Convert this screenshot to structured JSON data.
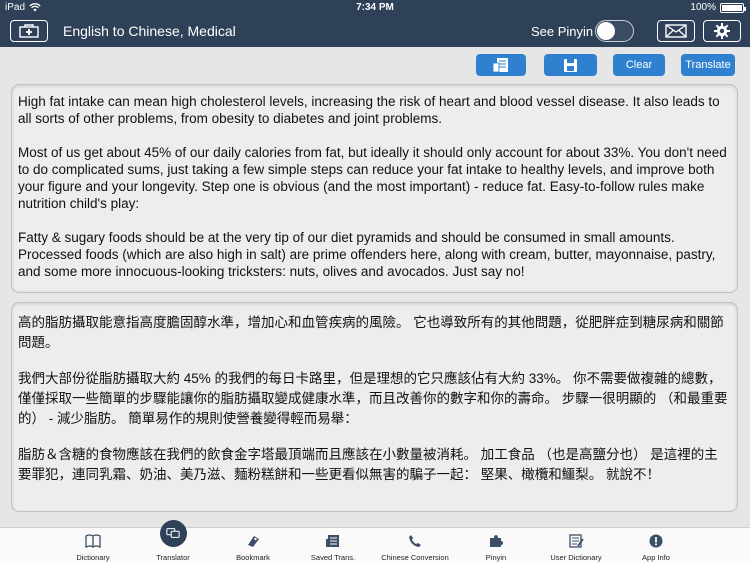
{
  "status_bar": {
    "device": "iPad",
    "time": "7:34 PM",
    "battery": "100%",
    "battery_level": 1.0
  },
  "navbar": {
    "title": "English to Chinese, Medical",
    "pinyin_label": "See Pinyin",
    "pinyin_toggle_on": false
  },
  "toolbar": {
    "clear_label": "Clear",
    "translate_label": "Translate"
  },
  "source_text": {
    "p1": "High fat intake can mean high cholesterol levels, increasing the risk of heart and blood vessel disease. It also leads to all sorts of other problems, from obesity to diabetes and joint problems.",
    "p2": "Most of us get about 45% of our daily calories from fat, but ideally it should only account for about 33%. You don't need to do complicated sums, just taking a few simple steps can reduce your fat intake to healthy levels, and improve both your figure and your longevity. Step one is obvious (and the most important) - reduce fat. Easy-to-follow rules make nutrition child's play:",
    "p3": "Fatty & sugary foods should be at the very tip of our diet pyramids and should be consumed in small amounts. Processed foods (which are also high in salt) are prime offenders here, along with cream, butter, mayonnaise, pastry, and some more innocuous-looking tricksters: nuts, olives and avocados. Just say no!"
  },
  "translated_text": {
    "p1": "高的脂肪攝取能意指高度膽固醇水準，增加心和血管疾病的風險。 它也導致所有的其他問題，從肥胖症到糖尿病和關節問題。",
    "p2": "我們大部份從脂肪攝取大約 45% 的我們的每日卡路里，但是理想的它只應該佔有大約 33%。 你不需要做複雜的總數，僅僅採取一些簡單的步驟能讓你的脂肪攝取變成健康水準，而且改善你的數字和你的壽命。 步驟一很明顯的 （和最重要的） - 減少脂肪。 簡單易作的規則使營養變得輕而易舉：",
    "p3": "脂肪＆含糖的食物應該在我們的飲食金字塔最頂端而且應該在小數量被消耗。 加工食品 （也是高鹽分也） 是這裡的主要罪犯，連同乳霜、奶油、美乃滋、麵粉糕餅和一些更看似無害的騙子一起： 堅果、橄欖和鱷梨。 就說不！"
  },
  "tabs": [
    {
      "label": "Dictionary",
      "icon": "book-icon"
    },
    {
      "label": "Translator",
      "icon": "translator-icon"
    },
    {
      "label": "Bookmark",
      "icon": "bookmark-icon"
    },
    {
      "label": "Saved Trans.",
      "icon": "saved-icon"
    },
    {
      "label": "Chinese Conversion",
      "icon": "phone-icon"
    },
    {
      "label": "Pinyin",
      "icon": "puzzle-icon"
    },
    {
      "label": "User Dictionary",
      "icon": "notebook-icon"
    },
    {
      "label": "App Info",
      "icon": "info-icon"
    }
  ],
  "colors": {
    "nav_bg": "#2f4158",
    "button_blue": "#2f80cf",
    "panel_bg": "#ededed"
  }
}
